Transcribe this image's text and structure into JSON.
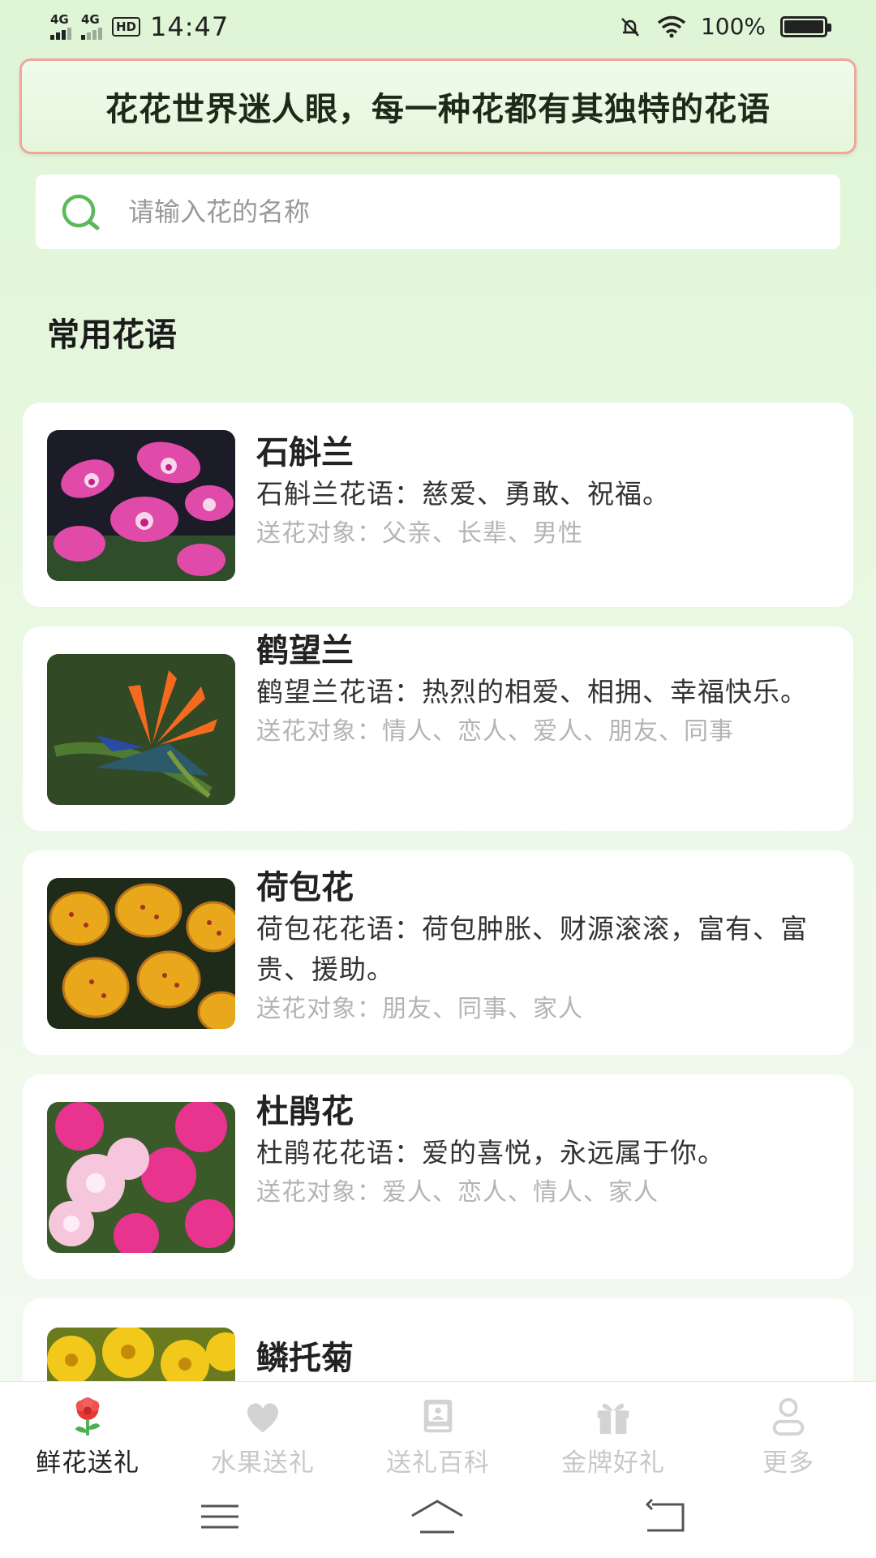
{
  "status_bar": {
    "sim1": "4G",
    "sim2": "4G",
    "hd": "HD",
    "time": "14:47",
    "battery": "100%"
  },
  "banner": {
    "text": "花花世界迷人眼，每一种花都有其独特的花语"
  },
  "search": {
    "placeholder": "请输入花的名称"
  },
  "section": {
    "title": "常用花语"
  },
  "flowers": [
    {
      "name": "石斛兰",
      "meaning": "石斛兰花语：慈爱、勇敢、祝福。",
      "target": "送花对象：父亲、长辈、男性"
    },
    {
      "name": "鹤望兰",
      "meaning": "鹤望兰花语：热烈的相爱、相拥、幸福快乐。",
      "target": "送花对象：情人、恋人、爱人、朋友、同事"
    },
    {
      "name": "荷包花",
      "meaning": "荷包花花语：荷包肿胀、财源滚滚，富有、富贵、援助。",
      "target": "送花对象：朋友、同事、家人"
    },
    {
      "name": "杜鹃花",
      "meaning": "杜鹃花花语：爱的喜悦，永远属于你。",
      "target": "送花对象：爱人、恋人、情人、家人"
    },
    {
      "name": "鳞托菊"
    }
  ],
  "bottom_nav": [
    {
      "label": "鲜花送礼",
      "icon": "flower-icon",
      "active": true
    },
    {
      "label": "水果送礼",
      "icon": "heart-icon",
      "active": false
    },
    {
      "label": "送礼百科",
      "icon": "book-icon",
      "active": false
    },
    {
      "label": "金牌好礼",
      "icon": "gift-icon",
      "active": false
    },
    {
      "label": "更多",
      "icon": "user-icon",
      "active": false
    }
  ],
  "colors": {
    "accent_green": "#5cb85c",
    "banner_border": "#f0a79a",
    "muted_text": "#b4b4b4"
  }
}
